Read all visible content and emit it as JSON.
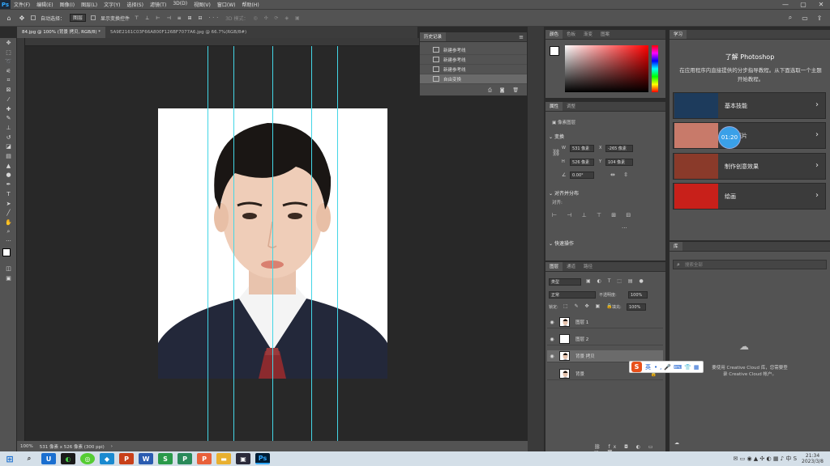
{
  "app": {
    "logo": "Ps"
  },
  "menu": [
    "文件(F)",
    "编辑(E)",
    "图像(I)",
    "图层(L)",
    "文字(Y)",
    "选择(S)",
    "滤镜(T)",
    "3D(D)",
    "视图(V)",
    "窗口(W)",
    "帮助(H)"
  ],
  "window_controls": [
    "—",
    "▢",
    "✕"
  ],
  "options_bar": {
    "auto_select_label": "自动选择：",
    "auto_select_value": "图层",
    "transform_label": "显示变换控件",
    "mode_label": "3D 模式："
  },
  "doc_tabs": [
    "84.jpg @ 100% (背景 拷贝, RGB/8) *",
    "5A9E2161C03F66A800F126BF7077A6.jpg @ 66.7%(RGB/8#)"
  ],
  "status": {
    "zoom": "100%",
    "doc_size": "531 像素 x 526 像素 (300 ppi)"
  },
  "history": {
    "tabs": [
      "历史记录"
    ],
    "items": [
      "新建参考线",
      "新建参考线",
      "新建参考线",
      "自由变换"
    ]
  },
  "color_panel": {
    "tabs": [
      "颜色",
      "色板",
      "渐变",
      "图案"
    ],
    "accent": "#ff0000",
    "foreground": "#ffffff"
  },
  "properties": {
    "tabs": [
      "属性",
      "调整"
    ],
    "layer_type": "像素图层",
    "transform_title": "变换",
    "w": "531 像素",
    "x": "-265 像素",
    "h": "526 像素",
    "y": "104 像素",
    "angle": "0.00°",
    "align_title": "对齐并分布",
    "align_label": "对齐:",
    "quick_actions": "快速操作",
    "more": "···"
  },
  "learn": {
    "tab": "学习",
    "title": "了解 Photoshop",
    "desc": "在应用程序内直接提供的分步指导教程。从下面选取一个主题开始教程。",
    "cards": [
      {
        "label": "基本技能",
        "color": "#1d3b5c"
      },
      {
        "label": "修复照片",
        "color": "#c87a6a"
      },
      {
        "label": "制作创意效果",
        "color": "#8a3a2a"
      },
      {
        "label": "绘画",
        "color": "#c8201a"
      }
    ],
    "overlay_time": "01:20"
  },
  "libraries": {
    "tab": "库",
    "search_placeholder": "搜索全部",
    "cc_message_1": "要使用 Creative Cloud 库，您需要登",
    "cc_message_2": "录 Creative Cloud 帐户。"
  },
  "layers_panel": {
    "tabs": [
      "图层",
      "通道",
      "路径"
    ],
    "kind_label": "类型",
    "blend_mode": "正常",
    "opacity_label": "不透明度:",
    "opacity": "100%",
    "lock_label": "锁定:",
    "fill_label": "填充:",
    "fill": "100%",
    "layers": [
      {
        "name": "图层 1",
        "visible": true
      },
      {
        "name": "图层 2",
        "visible": true
      },
      {
        "name": "背景 拷贝",
        "visible": true,
        "selected": true
      },
      {
        "name": "背景",
        "visible": false
      }
    ]
  },
  "ime": {
    "label": "英"
  },
  "taskbar": {
    "time": "21:34",
    "date": "2023/3/8"
  }
}
